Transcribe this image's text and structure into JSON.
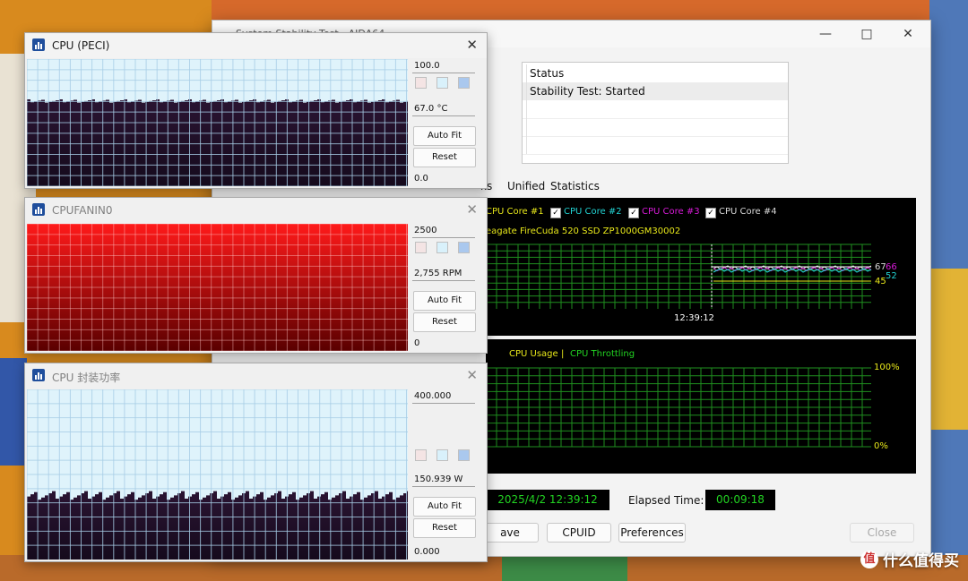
{
  "main_window": {
    "title": "System Stability Test - AIDA64",
    "status_header": "Status",
    "status_value": "Stability Test: Started",
    "tabs": [
      "ks",
      "Unified",
      "Statistics"
    ],
    "temp_legend": [
      {
        "label": "CPU Core #1",
        "color": "#e8e81a",
        "checked": true,
        "partial": true
      },
      {
        "label": "CPU Core #2",
        "color": "#22d3d3",
        "checked": true
      },
      {
        "label": "CPU Core #3",
        "color": "#d81bd8",
        "checked": true
      },
      {
        "label": "CPU Core #4",
        "color": "#d8d8d8",
        "checked": true
      }
    ],
    "drive_label": "eagate FireCuda 520 SSD ZP1000GM30002",
    "temp_time_label": "12:39:12",
    "temp_readings": [
      "67",
      "66",
      "52",
      "45"
    ],
    "usage_legend": {
      "usage": "CPU Usage",
      "separator": "|",
      "throttling": "CPU Throttling"
    },
    "usage_scale_top": "100%",
    "usage_scale_bottom": "0%",
    "start_time": "2025/4/2 12:39:12",
    "elapsed_label": "Elapsed Time:",
    "elapsed_value": "00:09:18",
    "buttons": {
      "save": "ave",
      "cpuid": "CPUID",
      "preferences": "Preferences",
      "close": "Close"
    }
  },
  "sensor_windows": [
    {
      "title": "CPU (PECI)",
      "active": true,
      "max": "100.0",
      "current": "67.0 °C",
      "min": "0.0",
      "auto_fit": "Auto Fit",
      "reset": "Reset",
      "fill": "dark",
      "level_fraction": 0.67
    },
    {
      "title": "CPUFANIN0",
      "active": false,
      "max": "2500",
      "current": "2,755 RPM",
      "min": "0",
      "auto_fit": "Auto Fit",
      "reset": "Reset",
      "fill": "red",
      "level_fraction": 1.0
    },
    {
      "title": "CPU 封装功率",
      "active": false,
      "max": "400.000",
      "current": "150.939 W",
      "min": "0.000",
      "auto_fit": "Auto Fit",
      "reset": "Reset",
      "fill": "dark",
      "level_fraction": 0.377
    }
  ],
  "watermark": {
    "badge": "值",
    "text": "什么值得买"
  }
}
